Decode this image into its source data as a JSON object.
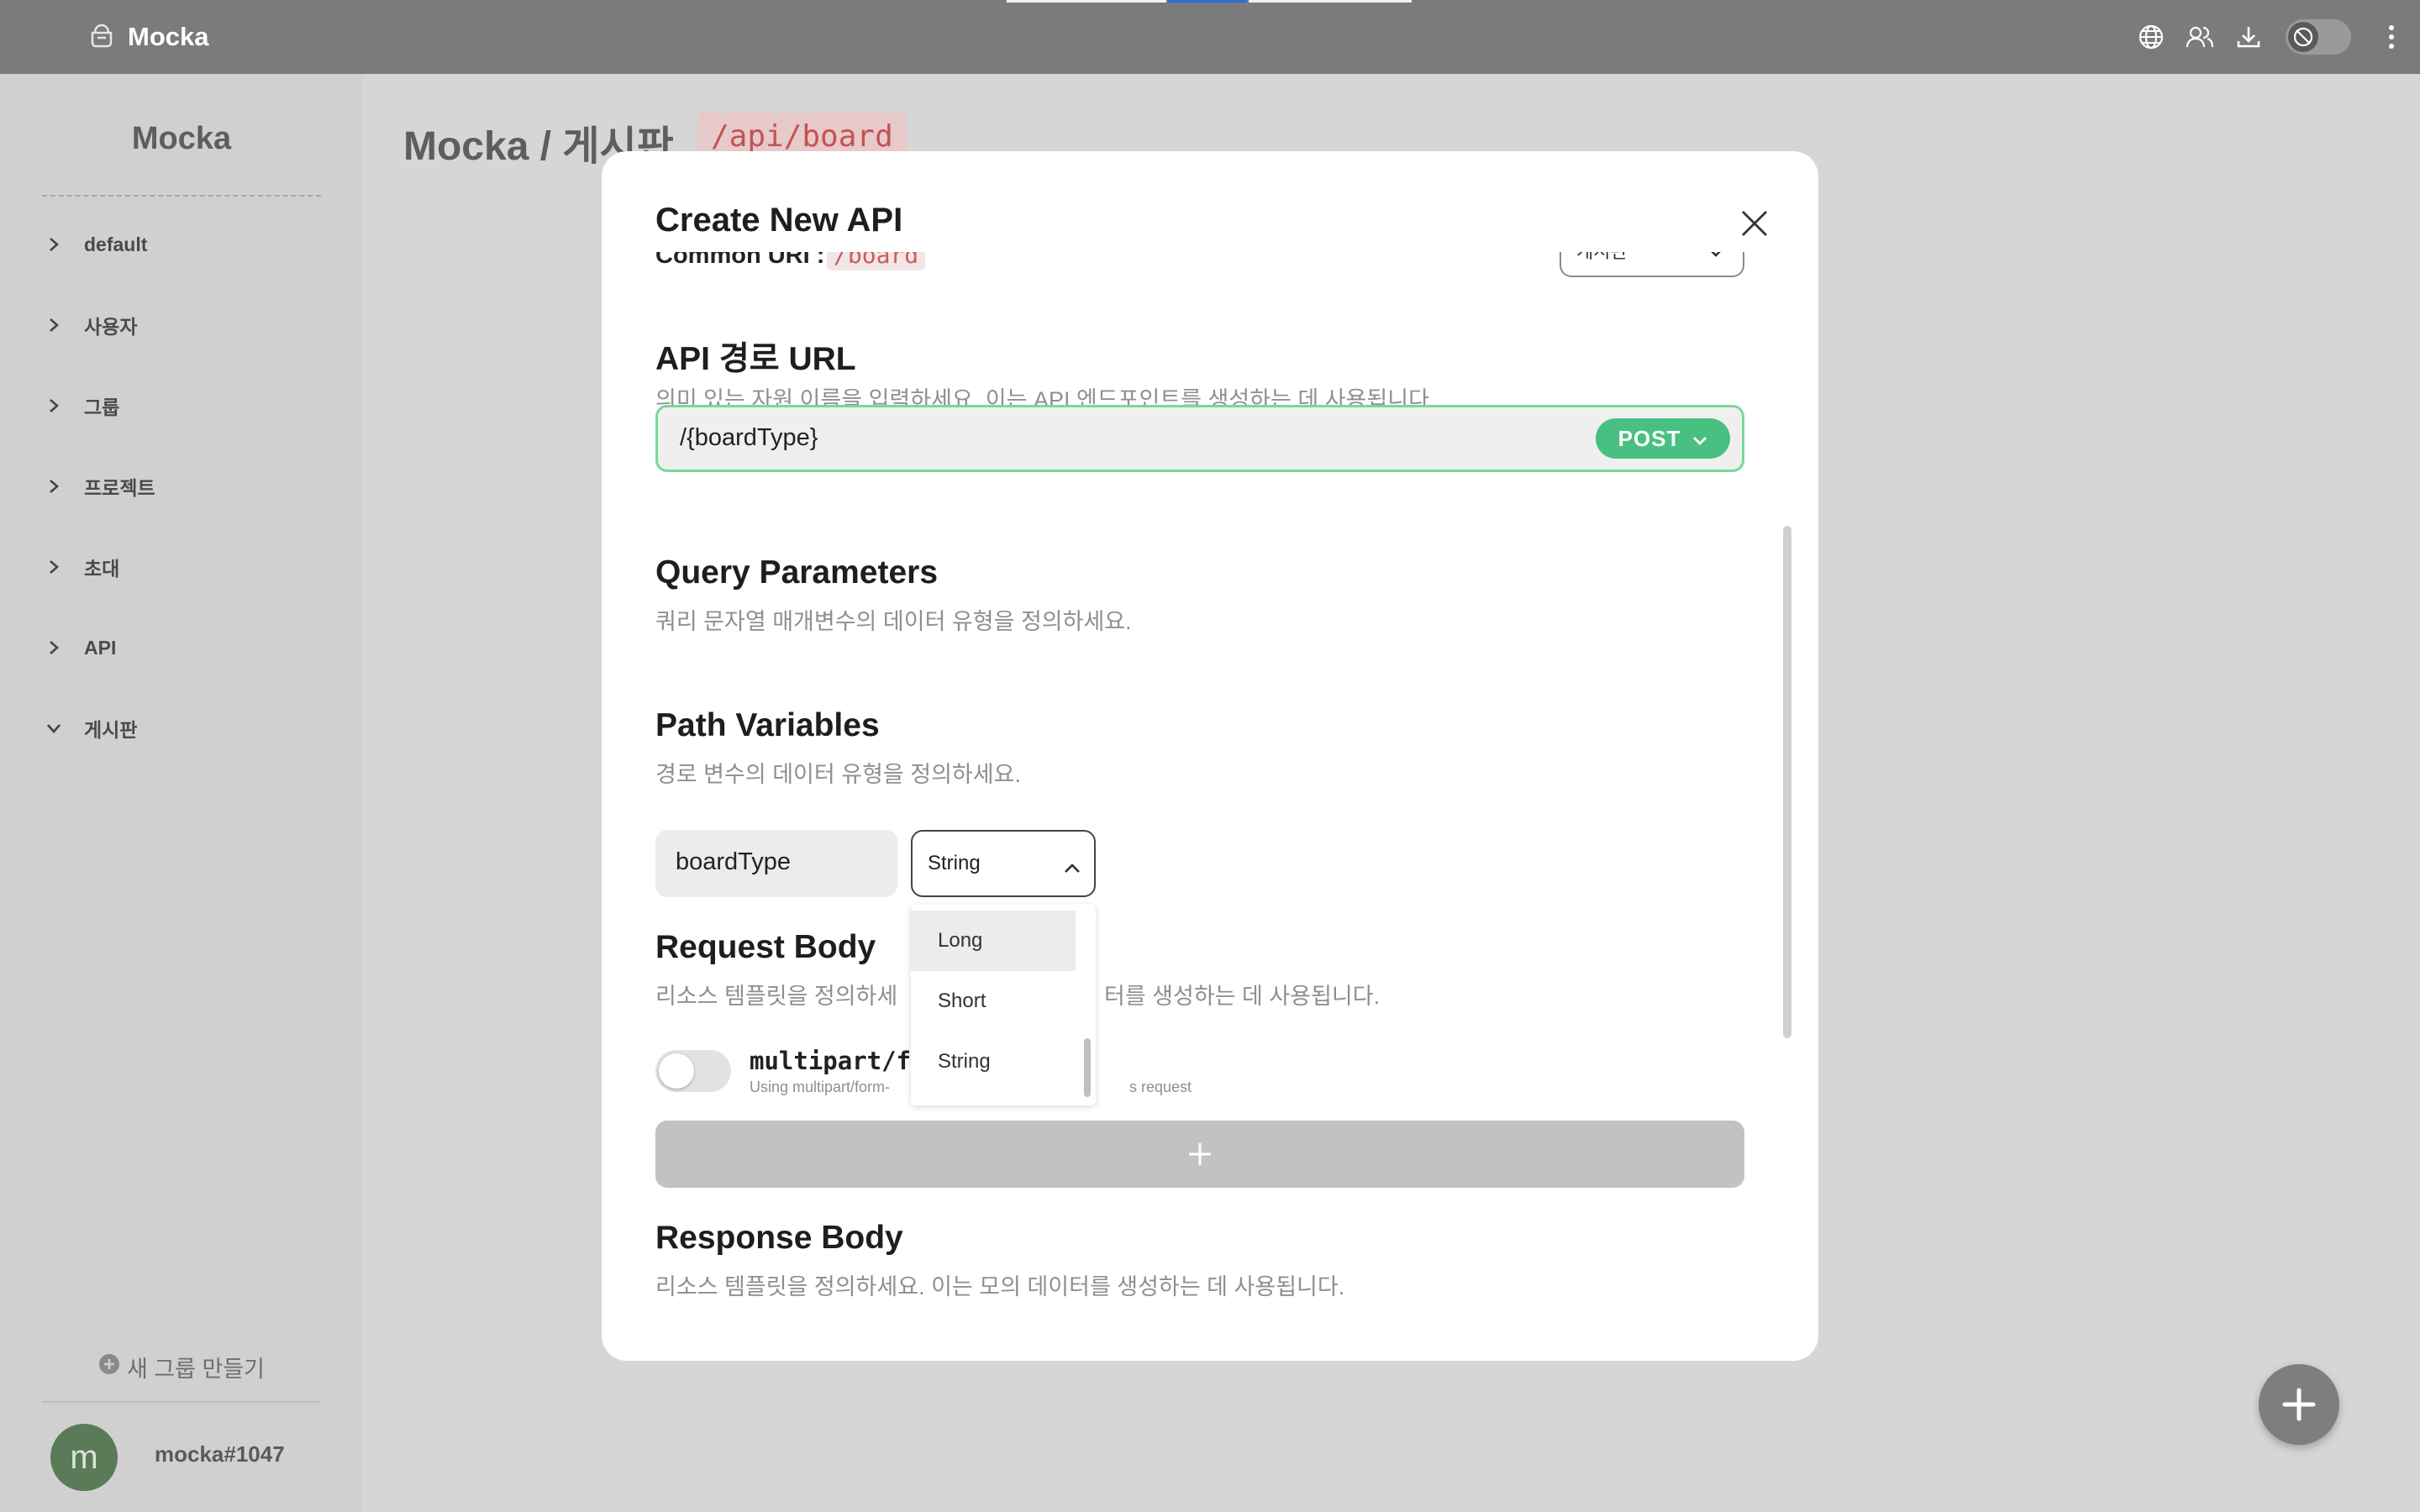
{
  "app": {
    "name": "Mocka"
  },
  "topbar": {
    "brand": "Mocka",
    "progress_colors": [
      "#f4f4f4",
      "#2b6fd6",
      "#f4f4f4"
    ],
    "icons": [
      "globe-icon",
      "users-icon",
      "download-icon",
      "theme-toggle",
      "more-vertical-icon"
    ]
  },
  "sidebar": {
    "title": "Mocka",
    "items": [
      {
        "label": "default",
        "expanded": false
      },
      {
        "label": "사용자",
        "expanded": false
      },
      {
        "label": "그룹",
        "expanded": false
      },
      {
        "label": "프로젝트",
        "expanded": false
      },
      {
        "label": "초대",
        "expanded": false
      },
      {
        "label": "API",
        "expanded": false
      },
      {
        "label": "게시판",
        "expanded": true
      }
    ],
    "new_group": "새 그룹 만들기",
    "user": {
      "avatar_letter": "m",
      "name": "mocka#1047"
    }
  },
  "page": {
    "title": "Mocka / 게시판",
    "path": "/api/board"
  },
  "modal": {
    "title": "Create New API",
    "common_uri_label": "Common URI :",
    "common_uri_value": "/board",
    "group_select": "게시판",
    "api_url": {
      "title": "API 경로 URL",
      "desc": "의미 있는 자원 이름을 입력하세요. 이는 API 엔드포인트를 생성하는 데 사용됩니다.",
      "value": "/{boardType}",
      "method": "POST"
    },
    "query_params": {
      "title": "Query Parameters",
      "desc": "쿼리 문자열 매개변수의 데이터 유형을 정의하세요."
    },
    "path_vars": {
      "title": "Path Variables",
      "desc": "경로 변수의 데이터 유형을 정의하세요.",
      "name": "boardType",
      "type": "String",
      "options": [
        "Long",
        "Short",
        "String"
      ],
      "highlighted": "Long"
    },
    "request_body": {
      "title": "Request Body",
      "desc_left": "리소스 템플릿을 정의하세",
      "desc_right": "터를 생성하는 데 사용됩니다.",
      "multipart_label": "multipart/f",
      "multipart_desc_left": "Using multipart/form-",
      "multipart_desc_right": "s request",
      "add_symbol": "+"
    },
    "response_body": {
      "title": "Response Body",
      "desc": "리소스 템플릿을 정의하세요. 이는 모의 데이터를 생성하는 데 사용됩니다."
    }
  },
  "colors": {
    "accent_green": "#49c081",
    "path_red": "#c45252",
    "topbar": "#7b7b7b"
  }
}
